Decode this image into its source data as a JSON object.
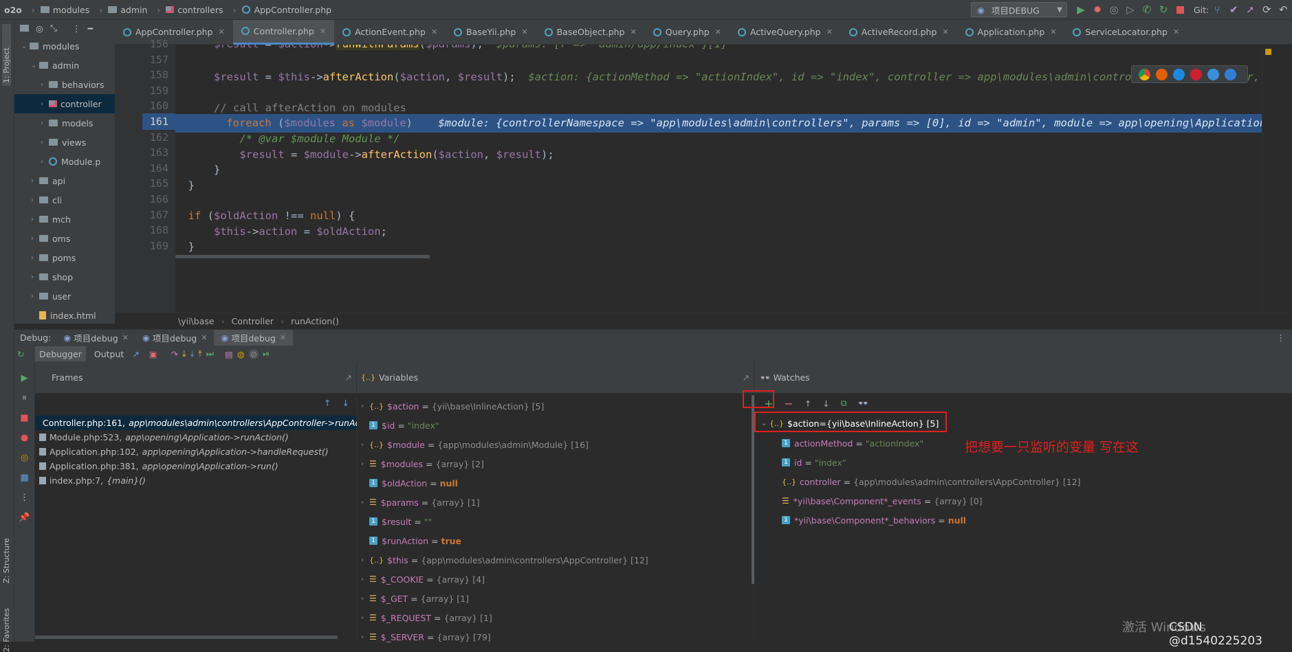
{
  "navbar": {
    "crumbs": [
      "o2o",
      "modules",
      "admin",
      "controllers",
      "AppController.php"
    ],
    "run_config": "项目DEBUG",
    "git_label": "Git:"
  },
  "leftstrip": {
    "project": "1: Project",
    "structure": "Z: Structure",
    "favorites": "2: Favorites"
  },
  "project": {
    "items": [
      {
        "label": "modules",
        "depth": 0,
        "open": true
      },
      {
        "label": "admin",
        "depth": 1,
        "open": true
      },
      {
        "label": "behaviors",
        "depth": 2
      },
      {
        "label": "controller",
        "depth": 2,
        "selected": true
      },
      {
        "label": "models",
        "depth": 2
      },
      {
        "label": "views",
        "depth": 2
      },
      {
        "label": "Module.p",
        "depth": 2,
        "php": true
      },
      {
        "label": "api",
        "depth": 1
      },
      {
        "label": "cli",
        "depth": 1
      },
      {
        "label": "mch",
        "depth": 1
      },
      {
        "label": "oms",
        "depth": 1
      },
      {
        "label": "poms",
        "depth": 1
      },
      {
        "label": "shop",
        "depth": 1
      },
      {
        "label": "user",
        "depth": 1
      },
      {
        "label": "index.html",
        "depth": 1,
        "file": true
      }
    ]
  },
  "tabs": [
    "AppController.php",
    "Controller.php",
    "ActionEvent.php",
    "BaseYii.php",
    "BaseObject.php",
    "Query.php",
    "ActiveQuery.php",
    "ActiveRecord.php",
    "Application.php",
    "ServiceLocator.php"
  ],
  "active_tab": 1,
  "code": {
    "line_numbers": [
      "156",
      "157",
      "158",
      "159",
      "160",
      "161",
      "162",
      "163",
      "164",
      "165",
      "166",
      "167",
      "168",
      "169"
    ],
    "hint_156": "$params: [r => \"admin/app/index\"][1]",
    "hint_158": "$action: {actionMethod => \"actionIndex\", id => \"index\", controller => app\\modules\\admin\\controllers\\AppController, +",
    "comment_160": "// call afterAction on modules",
    "hint_161": "$module: {controllerNamespace => \"app\\modules\\admin\\controllers\", params => [0], id => \"admin\", module => app\\opening\\Application",
    "phpdoc_162": "/* @var $module Module */"
  },
  "editor_crumbs": [
    "\\yii\\base",
    "Controller",
    "runAction()"
  ],
  "debug": {
    "label": "Debug:",
    "sessions": [
      "项目debug",
      "项目debug",
      "项目debug"
    ],
    "subtabs": [
      "Debugger",
      "Output"
    ],
    "frames_title": "Frames",
    "variables_title": "Variables",
    "watches_title": "Watches",
    "frames": [
      {
        "file": "Controller.php:161,",
        "ctx": "app\\modules\\admin\\controllers\\AppController->runActi"
      },
      {
        "file": "Module.php:523,",
        "ctx": "app\\opening\\Application->runAction()"
      },
      {
        "file": "Application.php:102,",
        "ctx": "app\\opening\\Application->handleRequest()"
      },
      {
        "file": "Application.php:381,",
        "ctx": "app\\opening\\Application->run()"
      },
      {
        "file": "index.php:7,",
        "ctx": "{main}()"
      }
    ],
    "variables": [
      {
        "name": "$action",
        "eq": " = ",
        "type": "{yii\\base\\InlineAction} [5]",
        "kind": "obj",
        "expand": true
      },
      {
        "name": "$id",
        "eq": " = ",
        "value": "\"index\"",
        "kind": "prim"
      },
      {
        "name": "$module",
        "eq": " = ",
        "type": "{app\\modules\\admin\\Module} [16]",
        "kind": "obj",
        "expand": true
      },
      {
        "name": "$modules",
        "eq": " = ",
        "type": "{array} [2]",
        "kind": "arr",
        "expand": true
      },
      {
        "name": "$oldAction",
        "eq": " = ",
        "null": "null",
        "kind": "prim"
      },
      {
        "name": "$params",
        "eq": " = ",
        "type": "{array} [1]",
        "kind": "arr",
        "expand": true
      },
      {
        "name": "$result",
        "eq": " = ",
        "value": "\"\"",
        "kind": "prim"
      },
      {
        "name": "$runAction",
        "eq": " = ",
        "null": "true",
        "kind": "prim"
      },
      {
        "name": "$this",
        "eq": " = ",
        "type": "{app\\modules\\admin\\controllers\\AppController} [12]",
        "kind": "obj",
        "expand": true
      },
      {
        "name": "$_COOKIE",
        "eq": " = ",
        "type": "{array} [4]",
        "kind": "arr",
        "expand": true
      },
      {
        "name": "$_GET",
        "eq": " = ",
        "type": "{array} [1]",
        "kind": "arr",
        "expand": true
      },
      {
        "name": "$_REQUEST",
        "eq": " = ",
        "type": "{array} [1]",
        "kind": "arr",
        "expand": true
      },
      {
        "name": "$_SERVER",
        "eq": " = ",
        "type": "{array} [79]",
        "kind": "arr",
        "expand": true
      }
    ],
    "watch_root": {
      "name": "$action",
      "eq": " = ",
      "type": "{yii\\base\\InlineAction} [5]"
    },
    "watch_children": [
      {
        "name": "actionMethod",
        "eq": " = ",
        "value": "\"actionIndex\"",
        "kind": "prim"
      },
      {
        "name": "id",
        "eq": " = ",
        "value": "\"index\"",
        "kind": "prim"
      },
      {
        "name": "controller",
        "eq": " = ",
        "type": "{app\\modules\\admin\\controllers\\AppController} [12]",
        "kind": "obj"
      },
      {
        "name": "*yii\\base\\Component*_events",
        "eq": " = ",
        "type": "{array} [0]",
        "kind": "arr"
      },
      {
        "name": "*yii\\base\\Component*_behaviors",
        "eq": " = ",
        "null": "null",
        "kind": "prim"
      }
    ]
  },
  "annotation": "把想要一只监听的变量 写在这",
  "watermark": {
    "activate": "激活 Windows",
    "csdn": "CSDN @d1540225203"
  },
  "colors": {
    "highlight_line": "#2d5385",
    "annotation_red": "#e21f1f",
    "accent_blue": "#4a88c7"
  }
}
